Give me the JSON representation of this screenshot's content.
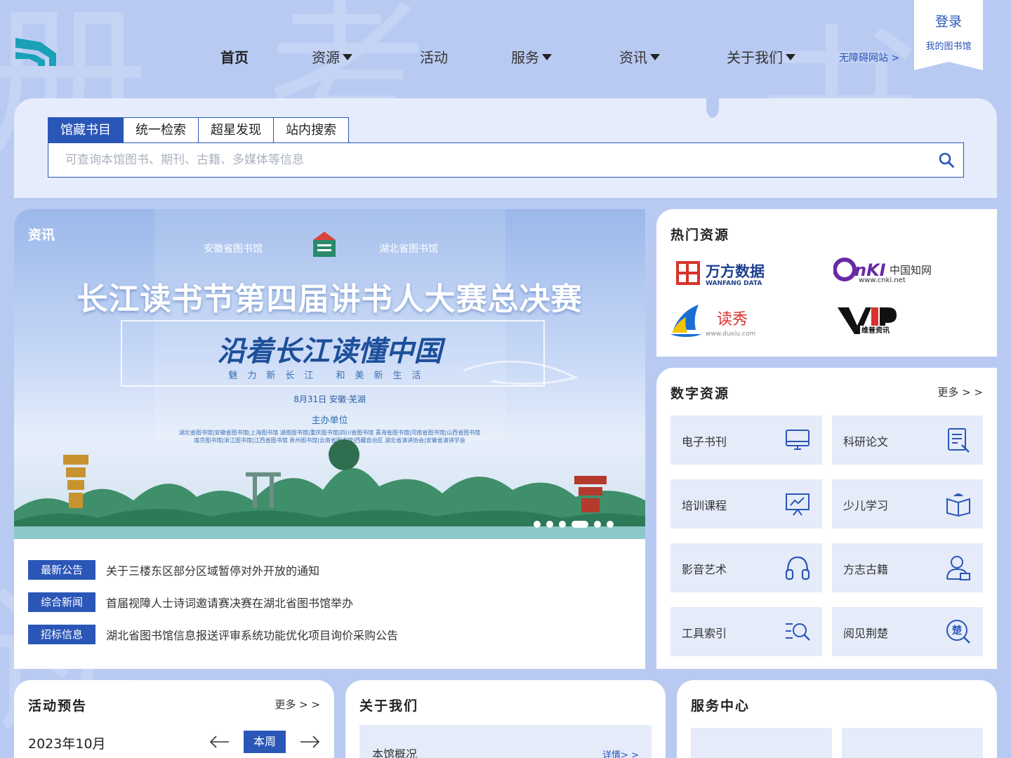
{
  "nav": {
    "items": [
      {
        "label": "首页"
      },
      {
        "label": "资源"
      },
      {
        "label": "活动"
      },
      {
        "label": "服务"
      },
      {
        "label": "资讯"
      },
      {
        "label": "关于我们"
      }
    ],
    "accessible": "无障碍网站 >",
    "login": "登录",
    "my_library": "我的图书馆"
  },
  "search": {
    "tabs": [
      "馆藏书目",
      "统一检索",
      "超星发现",
      "站内搜索"
    ],
    "active_tab": "馆藏书目",
    "placeholder": "可查询本馆图书、期刊、古籍、多媒体等信息",
    "value": ""
  },
  "news": {
    "banner_label": "资讯",
    "banner": {
      "logos": [
        "安徽省图书馆",
        "湖北省图书馆"
      ],
      "title": "长江读书节第四届讲书人大赛总决赛",
      "slogan": "沿着长江读懂中国",
      "subtitle": "魅力新长江  和美新生活",
      "date": "8月31日  安徽·芜湖",
      "host_label": "主办单位",
      "orgs_line1": "湖北省图书馆|安徽省图书馆|上海图书馆   湖南图书馆|重庆图书馆|四川省图书馆   青海省图书馆|河南省图书馆|山西省图书馆",
      "orgs_line2": "南京图书馆|浙江图书馆|江西省图书馆   贵州图书馆|云南省图书馆|西藏自治区   湖北省演讲协会|安徽省演讲学会"
    },
    "slides": 6,
    "active_slide": 3,
    "items": [
      {
        "tag": "最新公告",
        "text": "关于三楼东区部分区域暂停对外开放的通知"
      },
      {
        "tag": "综合新闻",
        "text": "首届视障人士诗词邀请赛决赛在湖北省图书馆举办"
      },
      {
        "tag": "招标信息",
        "text": "湖北省图书馆信息报送评审系统功能优化项目询价采购公告"
      }
    ]
  },
  "hot": {
    "title": "热门资源",
    "resources": [
      {
        "name": "万方数据",
        "sub": "WANFANG DATA"
      },
      {
        "name": "中国知网",
        "sub": "www.cnki.net"
      },
      {
        "name": "读秀",
        "sub": "www.duxiu.com"
      },
      {
        "name": "维普资讯",
        "sub": "VIP"
      }
    ]
  },
  "digital": {
    "title": "数字资源",
    "more": "更多 > >",
    "items": [
      {
        "label": "电子书刊",
        "icon": "monitor-icon"
      },
      {
        "label": "科研论文",
        "icon": "document-icon"
      },
      {
        "label": "培训课程",
        "icon": "presentation-icon"
      },
      {
        "label": "少儿学习",
        "icon": "open-book-icon"
      },
      {
        "label": "影音艺术",
        "icon": "headphones-icon"
      },
      {
        "label": "方志古籍",
        "icon": "person-book-icon"
      },
      {
        "label": "工具索引",
        "icon": "search-list-icon"
      },
      {
        "label": "阅见荆楚",
        "icon": "chu-search-icon"
      }
    ]
  },
  "activity": {
    "title": "活动预告",
    "more": "更多 > >",
    "month": "2023年10月",
    "week_button": "本周"
  },
  "about": {
    "title": "关于我们",
    "item": "本馆概况",
    "detail": "详情> >"
  },
  "service": {
    "title": "服务中心"
  },
  "colors": {
    "primary": "#2a56b8",
    "page_bg": "#b9caf2",
    "tile_bg": "#e5ebf9"
  }
}
